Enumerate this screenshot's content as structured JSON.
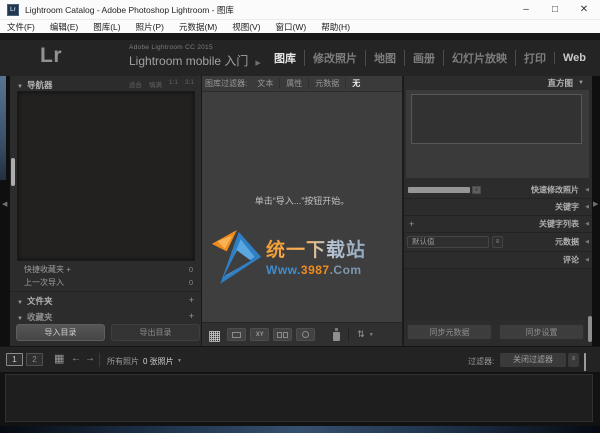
{
  "window": {
    "app_icon": "Lr",
    "title": "Lightroom Catalog - Adobe Photoshop Lightroom - 图库",
    "minimize": "–",
    "maximize": "□",
    "close": "✕"
  },
  "menubar": {
    "items": [
      "文件(F)",
      "编辑(E)",
      "图库(L)",
      "照片(P)",
      "元数据(M)",
      "视图(V)",
      "窗口(W)",
      "帮助(H)"
    ]
  },
  "header": {
    "logo": "Lr",
    "app_version": "Adobe Lightroom CC 2015",
    "identity": "Lightroom mobile 入门",
    "identity_arrow": "▶",
    "modules": [
      "图库",
      "修改照片",
      "地图",
      "画册",
      "幻灯片放映",
      "打印",
      "Web"
    ],
    "active_module": "图库"
  },
  "left_panel": {
    "navigator": {
      "collapse_icon": "▼",
      "title": "导航器",
      "zoom_fit": "适合",
      "zoom_fill": "填满",
      "zoom_1_1": "1:1",
      "zoom_3_1": "3:1"
    },
    "catalog_rows": [
      {
        "label": "快捷收藏夹 +",
        "count": "0"
      },
      {
        "label": "上一次导入",
        "count": "0"
      }
    ],
    "folders": {
      "collapse_icon": "▼",
      "title": "文件夹",
      "add": "+"
    },
    "collections": {
      "collapse_icon": "▼",
      "title": "收藏夹",
      "add": "+"
    },
    "import_button": "导入目录",
    "export_button": "导出目录"
  },
  "filter_bar": {
    "label": "图库过滤器:",
    "options": [
      "文本",
      "属性",
      "元数据",
      "无"
    ],
    "active_option": "无"
  },
  "center": {
    "empty_message": "单击“导入...”按钮开始。",
    "watermark": {
      "site_name": "统一下载站",
      "url_prefix": "Www.",
      "url_number": "3987",
      "url_suffix": ".Com",
      "orange": "#f08c1e",
      "blue": "#3e8ed0"
    }
  },
  "center_toolbar": {
    "grid_view_icon": "▦",
    "compare_label": "XY",
    "sort_icon": "⇅",
    "sort_dropdown": "▼"
  },
  "right_panel": {
    "histogram": {
      "title": "直方图",
      "collapse_icon": "▼"
    },
    "quick_develop": "快速修改照片",
    "keywording": "关键字",
    "keyword_list": "关键字列表",
    "keyword_list_add": "+",
    "metadata": "元数据",
    "metadata_preset": "默认值",
    "menu_glyph": "≡",
    "comments": "评论",
    "sync_metadata_button": "同步元数据",
    "sync_settings_button": "同步设置",
    "expand_icon": "◀"
  },
  "filmstrip_bar": {
    "monitor_1": "1",
    "monitor_2": "2",
    "grid_icon": "▦",
    "back_icon": "←",
    "forward_icon": "→",
    "source": "所有照片",
    "count": "0 张照片",
    "dropdown_icon": "▼",
    "filter_label": "过滤器:",
    "filter_value": "关闭过滤器",
    "filter_menu_glyph": "≡"
  },
  "collapse": {
    "top": "▲",
    "bottom": "▼",
    "left": "◀",
    "right": "▶"
  }
}
